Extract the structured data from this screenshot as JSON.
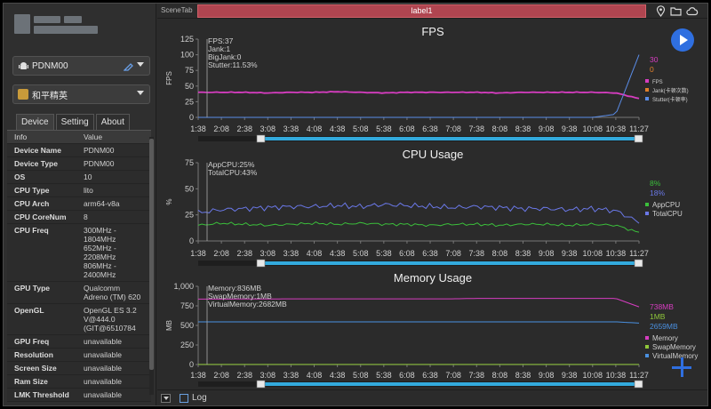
{
  "left_panel": {
    "device_select": "PDNM00",
    "app_select": "和平精英",
    "tabs": [
      "Device",
      "Setting",
      "About"
    ],
    "table_header": {
      "key": "Info",
      "value": "Value"
    },
    "rows": [
      {
        "key": "Device Name",
        "value": "PDNM00"
      },
      {
        "key": "Device Type",
        "value": "PDNM00"
      },
      {
        "key": "OS",
        "value": "10"
      },
      {
        "key": "CPU Type",
        "value": "lito"
      },
      {
        "key": "CPU Arch",
        "value": "arm64-v8a"
      },
      {
        "key": "CPU CoreNum",
        "value": "8"
      },
      {
        "key": "CPU Freq",
        "value": "300MHz -\n1804MHz\n652MHz -\n2208MHz\n806MHz -\n2400MHz"
      },
      {
        "key": "GPU Type",
        "value": "Qualcomm\nAdreno (TM) 620"
      },
      {
        "key": "OpenGL",
        "value": "OpenGL ES 3.2\nV@444.0\n(GIT@6510784"
      },
      {
        "key": "GPU Freq",
        "value": "unavailable"
      },
      {
        "key": "Resolution",
        "value": "unavailable"
      },
      {
        "key": "Screen Size",
        "value": "unavailable"
      },
      {
        "key": "Ram Size",
        "value": "unavailable"
      },
      {
        "key": "LMK Threshold",
        "value": "unavailable"
      }
    ]
  },
  "top_bar": {
    "scene_tab": "SceneTab",
    "label": "label1",
    "icons": [
      "location-icon",
      "folder-icon",
      "cloud-icon"
    ]
  },
  "bottom_bar": {
    "log_label": "Log"
  },
  "x_ticks": [
    "1:38",
    "2:08",
    "2:38",
    "3:08",
    "3:38",
    "4:08",
    "4:38",
    "5:08",
    "5:38",
    "6:08",
    "6:38",
    "7:08",
    "7:38",
    "8:08",
    "8:38",
    "9:08",
    "9:38",
    "10:08",
    "10:38",
    "11:27"
  ],
  "chart_data": [
    {
      "type": "line",
      "title": "FPS",
      "ylabel": "FPS",
      "ylim": [
        0,
        125
      ],
      "yticks": [
        0,
        25,
        50,
        75,
        100,
        125
      ],
      "annotations": [
        "FPS:37",
        "Jank:1",
        "BigJank:0",
        "Stutter:11.53%"
      ],
      "current_values": [
        "30",
        "0"
      ],
      "legend": [
        "FPS",
        "Jank(卡顿次数)",
        "Stutter(卡顿率)"
      ],
      "legend_position": "right",
      "colors": {
        "FPS": "#d63dc0",
        "Jank": "#e0802a",
        "Stutter": "#5a8de8"
      },
      "series": [
        {
          "name": "FPS",
          "values": [
            40,
            40,
            40,
            39,
            40,
            40,
            41,
            40,
            39,
            40,
            40,
            40,
            40,
            39,
            40,
            40,
            40,
            40,
            39,
            30
          ]
        },
        {
          "name": "Stutter(卡顿率)",
          "values": [
            0,
            0,
            0,
            0,
            0,
            0,
            0,
            0,
            0,
            0,
            0,
            0,
            0,
            0,
            0,
            0,
            0,
            0,
            5,
            100
          ]
        }
      ]
    },
    {
      "type": "line",
      "title": "CPU Usage",
      "ylabel": "%",
      "ylim": [
        0,
        75
      ],
      "yticks": [
        0,
        25,
        50,
        75
      ],
      "annotations": [
        "AppCPU:25%",
        "TotalCPU:43%"
      ],
      "current_values": [
        "8%",
        "18%"
      ],
      "legend": [
        "AppCPU",
        "TotalCPU"
      ],
      "legend_position": "right",
      "colors": {
        "AppCPU": "#3bbf3b",
        "TotalCPU": "#6a78e8"
      },
      "series": [
        {
          "name": "AppCPU",
          "values": [
            15,
            17,
            16,
            15,
            16,
            17,
            16,
            17,
            16,
            16,
            15,
            16,
            16,
            15,
            16,
            16,
            15,
            16,
            15,
            8
          ]
        },
        {
          "name": "TotalCPU",
          "values": [
            27,
            30,
            31,
            32,
            33,
            33,
            34,
            33,
            35,
            34,
            33,
            32,
            33,
            32,
            31,
            31,
            30,
            31,
            29,
            18
          ]
        }
      ]
    },
    {
      "type": "line",
      "title": "Memory Usage",
      "ylabel": "MB",
      "ylim": [
        0,
        1000
      ],
      "yticks": [
        "0",
        "250",
        "500",
        "750",
        "1,000"
      ],
      "annotations": [
        "Memory:836MB",
        "SwapMemory:1MB",
        "VirtualMemory:2682MB"
      ],
      "current_values": [
        "738MB",
        "1MB",
        "2659MB"
      ],
      "legend": [
        "Memory",
        "SwapMemory",
        "VirtualMemory"
      ],
      "legend_position": "right",
      "colors": {
        "Memory": "#d63dc0",
        "SwapMemory": "#8fc83a",
        "VirtualMemory": "#4a90e0"
      },
      "series": [
        {
          "name": "Memory",
          "values": [
            836,
            836,
            838,
            838,
            840,
            840,
            840,
            840,
            840,
            840,
            840,
            840,
            845,
            845,
            845,
            845,
            845,
            845,
            845,
            738
          ]
        },
        {
          "name": "SwapMemory",
          "values": [
            1,
            1,
            1,
            1,
            1,
            1,
            1,
            1,
            1,
            1,
            1,
            1,
            1,
            1,
            1,
            1,
            1,
            1,
            1,
            1
          ]
        },
        {
          "name": "VirtualMemory",
          "values": [
            545,
            545,
            545,
            545,
            545,
            546,
            546,
            546,
            546,
            546,
            546,
            546,
            546,
            546,
            546,
            546,
            546,
            546,
            546,
            530
          ]
        }
      ]
    }
  ]
}
